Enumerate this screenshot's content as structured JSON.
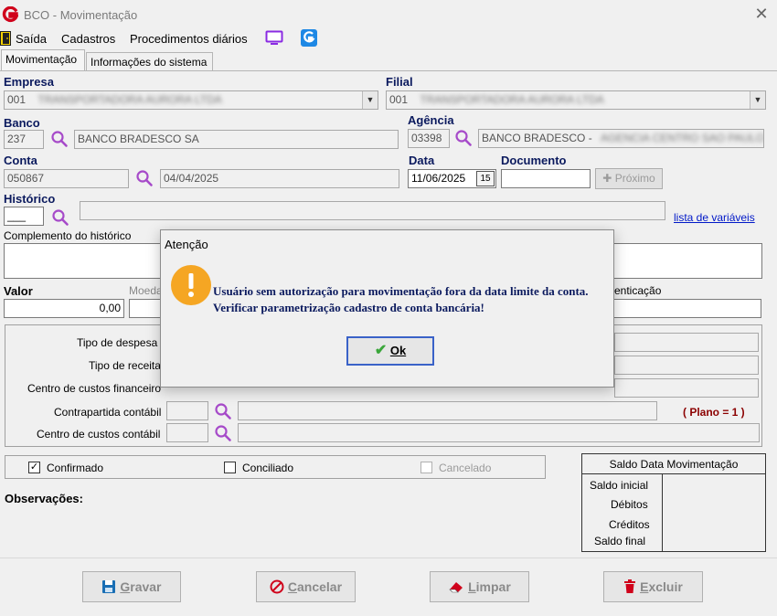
{
  "window": {
    "title": "BCO - Movimentação"
  },
  "menu": {
    "exit": "Saída",
    "cadastros": "Cadastros",
    "procedimentos": "Procedimentos diários"
  },
  "tabs": [
    {
      "label": "Movimentação"
    },
    {
      "label": "Informações do sistema"
    }
  ],
  "empresa": {
    "label": "Empresa",
    "code": "001",
    "name": "TRANSPORTADORA AURORA LTDA"
  },
  "filial": {
    "label": "Filial",
    "code": "001",
    "name": "TRANSPORTADORA AURORA LTDA"
  },
  "banco": {
    "label": "Banco",
    "code": "237",
    "name": "BANCO BRADESCO SA"
  },
  "agencia": {
    "label": "Agência",
    "code": "03398",
    "name_visible": "BANCO BRADESCO -",
    "name_hidden": "AGENCIA CENTRO SAO PAULO"
  },
  "conta": {
    "label": "Conta",
    "number": "050867",
    "date_limit": "04/04/2025"
  },
  "data": {
    "label": "Data",
    "value": "11/06/2025"
  },
  "documento": {
    "label": "Documento",
    "value": "",
    "next_button": "Próximo"
  },
  "historico": {
    "label": "Histórico",
    "code": "___",
    "link": "lista de variáveis"
  },
  "complemento": {
    "label": "Complemento do histórico"
  },
  "valor": {
    "label": "Valor",
    "value": "0,00"
  },
  "moeda": {
    "label": "Moeda"
  },
  "autenticacao": {
    "label": "enticação"
  },
  "classificacao": {
    "tipo_despesa": "Tipo de despesa",
    "tipo_receita": "Tipo de receita",
    "centro_financeiro": "Centro de custos financeiro",
    "contrapartida": "Contrapartida contábil",
    "centro_contabil": "Centro de custos contábil",
    "plano": "( Plano = 1 )"
  },
  "status": {
    "confirmado": "Confirmado",
    "conciliado": "Conciliado",
    "cancelado": "Cancelado"
  },
  "observacoes": {
    "label": "Observações:"
  },
  "saldo": {
    "title": "Saldo Data Movimentação",
    "inicial": "Saldo inicial",
    "debitos": "Débitos",
    "creditos": "Créditos",
    "final": "Saldo final"
  },
  "buttons": {
    "gravar": {
      "hot": "G",
      "rest": "ravar"
    },
    "cancelar": {
      "hot": "C",
      "rest": "ancelar"
    },
    "limpar": {
      "hot": "L",
      "rest": "impar"
    },
    "excluir": {
      "hot": "E",
      "rest": "xcluir"
    }
  },
  "dialog": {
    "title": "Atenção",
    "message": "Usuário sem autorização para movimentação fora da data limite da conta. Verificar parametrização cadastro de conta bancária!",
    "ok": "Ok"
  },
  "colors": {
    "label_blue": "#0b1a5e",
    "link_blue": "#0018c8",
    "plano_red": "#8b0000",
    "warning_orange": "#f5a623",
    "lens_purple": "#a64ac9"
  }
}
